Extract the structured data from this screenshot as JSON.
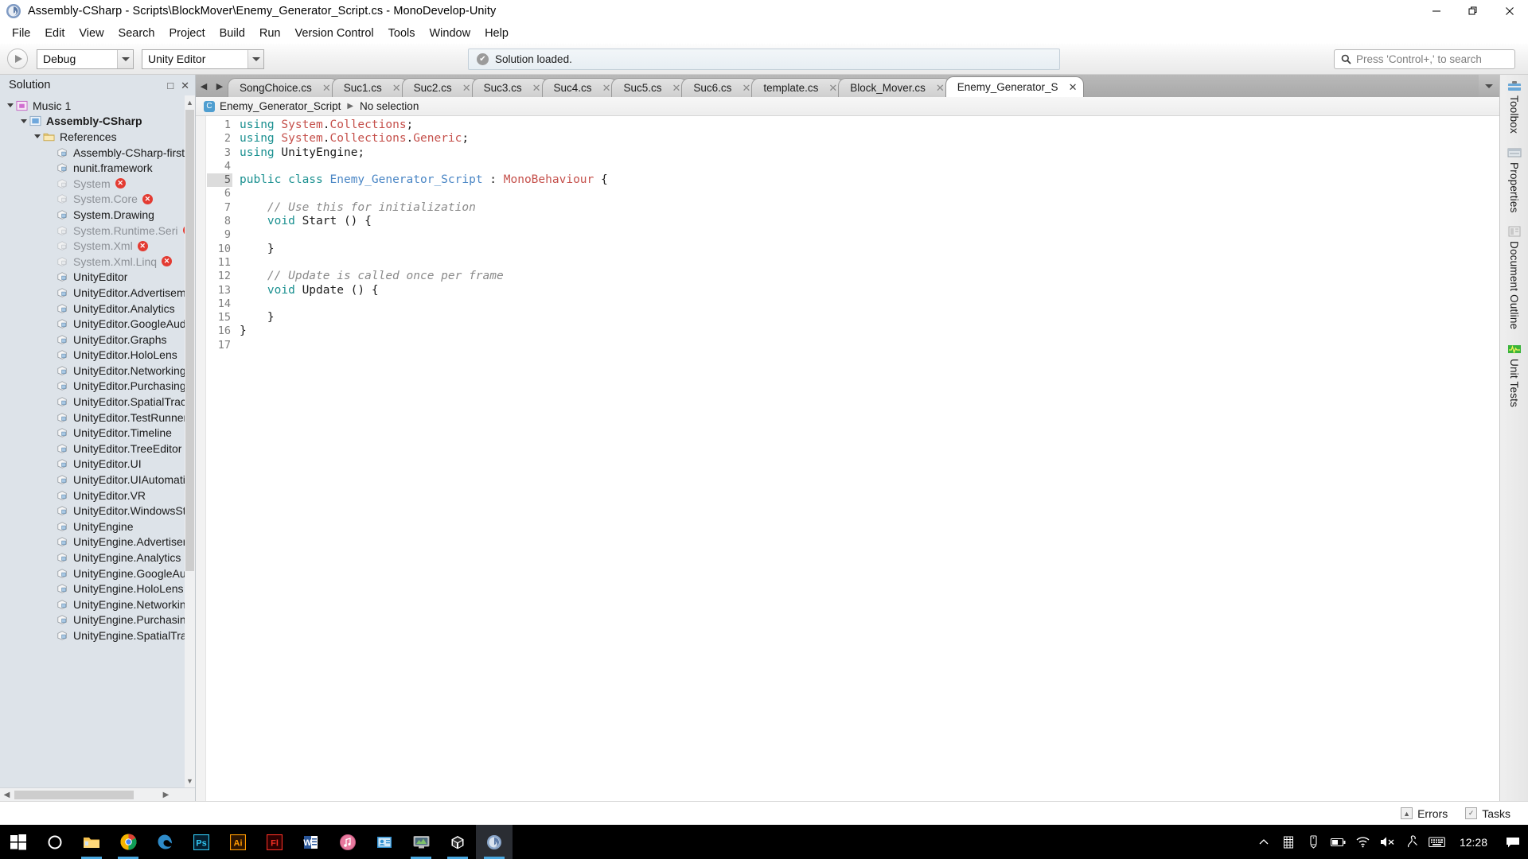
{
  "window": {
    "title": "Assembly-CSharp - Scripts\\BlockMover\\Enemy_Generator_Script.cs - MonoDevelop-Unity",
    "minimize": "─",
    "maximize": "❐",
    "close": "✕"
  },
  "menubar": {
    "items": [
      "File",
      "Edit",
      "View",
      "Search",
      "Project",
      "Build",
      "Run",
      "Version Control",
      "Tools",
      "Window",
      "Help"
    ]
  },
  "toolbar": {
    "run_label": "Run",
    "configuration": "Debug",
    "runtime": "Unity Editor",
    "status_message": "Solution loaded.",
    "status_icon": "✔",
    "search_placeholder": "Press 'Control+,' to search",
    "search_value": ""
  },
  "solution_pad": {
    "title": "Solution",
    "minimize_glyph": "□",
    "close_glyph": "✕",
    "tree": [
      {
        "label": "Music 1",
        "indent": 0,
        "expander": "down",
        "icon": "solution-icon",
        "dim": false,
        "bold": false,
        "error": false
      },
      {
        "label": "Assembly-CSharp",
        "indent": 1,
        "expander": "down",
        "icon": "project-icon",
        "dim": false,
        "bold": true,
        "error": false
      },
      {
        "label": "References",
        "indent": 2,
        "expander": "down",
        "icon": "folder-icon",
        "dim": false,
        "bold": false,
        "error": false
      },
      {
        "label": "Assembly-CSharp-firstpass",
        "indent": 3,
        "expander": "none",
        "icon": "assembly-icon",
        "dim": false,
        "bold": false,
        "error": false
      },
      {
        "label": "nunit.framework",
        "indent": 3,
        "expander": "none",
        "icon": "assembly-icon",
        "dim": false,
        "bold": false,
        "error": false
      },
      {
        "label": "System",
        "indent": 3,
        "expander": "none",
        "icon": "assembly-icon",
        "dim": true,
        "bold": false,
        "error": true
      },
      {
        "label": "System.Core",
        "indent": 3,
        "expander": "none",
        "icon": "assembly-icon",
        "dim": true,
        "bold": false,
        "error": true
      },
      {
        "label": "System.Drawing",
        "indent": 3,
        "expander": "none",
        "icon": "assembly-icon",
        "dim": false,
        "bold": false,
        "error": false
      },
      {
        "label": "System.Runtime.Serialization",
        "indent": 3,
        "expander": "none",
        "icon": "assembly-icon",
        "dim": true,
        "bold": false,
        "error": true
      },
      {
        "label": "System.Xml",
        "indent": 3,
        "expander": "none",
        "icon": "assembly-icon",
        "dim": true,
        "bold": false,
        "error": true
      },
      {
        "label": "System.Xml.Linq",
        "indent": 3,
        "expander": "none",
        "icon": "assembly-icon",
        "dim": true,
        "bold": false,
        "error": true
      },
      {
        "label": "UnityEditor",
        "indent": 3,
        "expander": "none",
        "icon": "assembly-icon",
        "dim": false,
        "bold": false,
        "error": false
      },
      {
        "label": "UnityEditor.Advertisements",
        "indent": 3,
        "expander": "none",
        "icon": "assembly-icon",
        "dim": false,
        "bold": false,
        "error": false
      },
      {
        "label": "UnityEditor.Analytics",
        "indent": 3,
        "expander": "none",
        "icon": "assembly-icon",
        "dim": false,
        "bold": false,
        "error": false
      },
      {
        "label": "UnityEditor.GoogleAudioSpatia",
        "indent": 3,
        "expander": "none",
        "icon": "assembly-icon",
        "dim": false,
        "bold": false,
        "error": false
      },
      {
        "label": "UnityEditor.Graphs",
        "indent": 3,
        "expander": "none",
        "icon": "assembly-icon",
        "dim": false,
        "bold": false,
        "error": false
      },
      {
        "label": "UnityEditor.HoloLens",
        "indent": 3,
        "expander": "none",
        "icon": "assembly-icon",
        "dim": false,
        "bold": false,
        "error": false
      },
      {
        "label": "UnityEditor.Networking",
        "indent": 3,
        "expander": "none",
        "icon": "assembly-icon",
        "dim": false,
        "bold": false,
        "error": false
      },
      {
        "label": "UnityEditor.Purchasing",
        "indent": 3,
        "expander": "none",
        "icon": "assembly-icon",
        "dim": false,
        "bold": false,
        "error": false
      },
      {
        "label": "UnityEditor.SpatialTracking",
        "indent": 3,
        "expander": "none",
        "icon": "assembly-icon",
        "dim": false,
        "bold": false,
        "error": false
      },
      {
        "label": "UnityEditor.TestRunner",
        "indent": 3,
        "expander": "none",
        "icon": "assembly-icon",
        "dim": false,
        "bold": false,
        "error": false
      },
      {
        "label": "UnityEditor.Timeline",
        "indent": 3,
        "expander": "none",
        "icon": "assembly-icon",
        "dim": false,
        "bold": false,
        "error": false
      },
      {
        "label": "UnityEditor.TreeEditor",
        "indent": 3,
        "expander": "none",
        "icon": "assembly-icon",
        "dim": false,
        "bold": false,
        "error": false
      },
      {
        "label": "UnityEditor.UI",
        "indent": 3,
        "expander": "none",
        "icon": "assembly-icon",
        "dim": false,
        "bold": false,
        "error": false
      },
      {
        "label": "UnityEditor.UIAutomation",
        "indent": 3,
        "expander": "none",
        "icon": "assembly-icon",
        "dim": false,
        "bold": false,
        "error": false
      },
      {
        "label": "UnityEditor.VR",
        "indent": 3,
        "expander": "none",
        "icon": "assembly-icon",
        "dim": false,
        "bold": false,
        "error": false
      },
      {
        "label": "UnityEditor.WindowsStandalone",
        "indent": 3,
        "expander": "none",
        "icon": "assembly-icon",
        "dim": false,
        "bold": false,
        "error": false
      },
      {
        "label": "UnityEngine",
        "indent": 3,
        "expander": "none",
        "icon": "assembly-icon",
        "dim": false,
        "bold": false,
        "error": false
      },
      {
        "label": "UnityEngine.Advertisements",
        "indent": 3,
        "expander": "none",
        "icon": "assembly-icon",
        "dim": false,
        "bold": false,
        "error": false
      },
      {
        "label": "UnityEngine.Analytics",
        "indent": 3,
        "expander": "none",
        "icon": "assembly-icon",
        "dim": false,
        "bold": false,
        "error": false
      },
      {
        "label": "UnityEngine.GoogleAudioSpatia",
        "indent": 3,
        "expander": "none",
        "icon": "assembly-icon",
        "dim": false,
        "bold": false,
        "error": false
      },
      {
        "label": "UnityEngine.HoloLens",
        "indent": 3,
        "expander": "none",
        "icon": "assembly-icon",
        "dim": false,
        "bold": false,
        "error": false
      },
      {
        "label": "UnityEngine.Networking",
        "indent": 3,
        "expander": "none",
        "icon": "assembly-icon",
        "dim": false,
        "bold": false,
        "error": false
      },
      {
        "label": "UnityEngine.Purchasing",
        "indent": 3,
        "expander": "none",
        "icon": "assembly-icon",
        "dim": false,
        "bold": false,
        "error": false
      },
      {
        "label": "UnityEngine.SpatialTracking",
        "indent": 3,
        "expander": "none",
        "icon": "assembly-icon",
        "dim": false,
        "bold": false,
        "error": false
      }
    ]
  },
  "tabs": {
    "prev_glyph": "◀",
    "next_glyph": "▶",
    "dropdown_glyph": "▼",
    "close_glyph": "✕",
    "items": [
      {
        "label": "SongChoice.cs",
        "active": false
      },
      {
        "label": "Suc1.cs",
        "active": false
      },
      {
        "label": "Suc2.cs",
        "active": false
      },
      {
        "label": "Suc3.cs",
        "active": false
      },
      {
        "label": "Suc4.cs",
        "active": false
      },
      {
        "label": "Suc5.cs",
        "active": false
      },
      {
        "label": "Suc6.cs",
        "active": false
      },
      {
        "label": "template.cs",
        "active": false
      },
      {
        "label": "Block_Mover.cs",
        "active": false
      },
      {
        "label": "Enemy_Generator_S",
        "active": true
      }
    ]
  },
  "breadcrumb": {
    "class_name": "Enemy_Generator_Script",
    "separator": "▶",
    "member": "No selection"
  },
  "editor": {
    "current_line": 5,
    "lines": [
      {
        "n": "1",
        "tokens": [
          {
            "t": "using ",
            "c": "kw"
          },
          {
            "t": "System",
            "c": "type"
          },
          {
            "t": ".",
            "c": "plain"
          },
          {
            "t": "Collections",
            "c": "type"
          },
          {
            "t": ";",
            "c": "plain"
          }
        ]
      },
      {
        "n": "2",
        "tokens": [
          {
            "t": "using ",
            "c": "kw"
          },
          {
            "t": "System",
            "c": "type"
          },
          {
            "t": ".",
            "c": "plain"
          },
          {
            "t": "Collections",
            "c": "type"
          },
          {
            "t": ".",
            "c": "plain"
          },
          {
            "t": "Generic",
            "c": "type"
          },
          {
            "t": ";",
            "c": "plain"
          }
        ]
      },
      {
        "n": "3",
        "tokens": [
          {
            "t": "using ",
            "c": "kw"
          },
          {
            "t": "UnityEngine",
            "c": "plain"
          },
          {
            "t": ";",
            "c": "plain"
          }
        ]
      },
      {
        "n": "4",
        "tokens": []
      },
      {
        "n": "5",
        "tokens": [
          {
            "t": "public ",
            "c": "kw"
          },
          {
            "t": "class ",
            "c": "kw"
          },
          {
            "t": "Enemy_Generator_Script",
            "c": "cls"
          },
          {
            "t": " : ",
            "c": "plain"
          },
          {
            "t": "MonoBehaviour",
            "c": "type"
          },
          {
            "t": " {",
            "c": "plain"
          }
        ]
      },
      {
        "n": "6",
        "tokens": []
      },
      {
        "n": "7",
        "tokens": [
          {
            "t": "    // Use this for initialization",
            "c": "cmt"
          }
        ]
      },
      {
        "n": "8",
        "tokens": [
          {
            "t": "    ",
            "c": "plain"
          },
          {
            "t": "void ",
            "c": "kw"
          },
          {
            "t": "Start () {",
            "c": "plain"
          }
        ]
      },
      {
        "n": "9",
        "tokens": []
      },
      {
        "n": "10",
        "tokens": [
          {
            "t": "    }",
            "c": "plain"
          }
        ]
      },
      {
        "n": "11",
        "tokens": []
      },
      {
        "n": "12",
        "tokens": [
          {
            "t": "    // Update is called once per frame",
            "c": "cmt"
          }
        ]
      },
      {
        "n": "13",
        "tokens": [
          {
            "t": "    ",
            "c": "plain"
          },
          {
            "t": "void ",
            "c": "kw"
          },
          {
            "t": "Update () {",
            "c": "plain"
          }
        ]
      },
      {
        "n": "14",
        "tokens": []
      },
      {
        "n": "15",
        "tokens": [
          {
            "t": "    }",
            "c": "plain"
          }
        ]
      },
      {
        "n": "16",
        "tokens": [
          {
            "t": "}",
            "c": "plain"
          }
        ]
      },
      {
        "n": "17",
        "tokens": []
      }
    ]
  },
  "right_dock": {
    "items": [
      {
        "label": "Toolbox",
        "icon": "toolbox-icon"
      },
      {
        "label": "Properties",
        "icon": "properties-icon"
      },
      {
        "label": "Document Outline",
        "icon": "document-outline-icon"
      },
      {
        "label": "Unit Tests",
        "icon": "unit-tests-icon"
      }
    ]
  },
  "bottom_status": {
    "errors_label": "Errors",
    "errors_glyph": "▲",
    "tasks_label": "Tasks",
    "tasks_glyph": "✓"
  },
  "taskbar": {
    "apps": [
      {
        "name": "start-button",
        "glyph": "start",
        "active": false,
        "running": false
      },
      {
        "name": "cortana-search",
        "glyph": "cortana",
        "active": false,
        "running": false
      },
      {
        "name": "file-explorer",
        "glyph": "folder",
        "active": false,
        "running": true
      },
      {
        "name": "google-chrome",
        "glyph": "chrome",
        "active": false,
        "running": true
      },
      {
        "name": "microsoft-edge",
        "glyph": "edge",
        "active": false,
        "running": false
      },
      {
        "name": "photoshop",
        "glyph": "Ps",
        "active": false,
        "running": false
      },
      {
        "name": "illustrator",
        "glyph": "Ai",
        "active": false,
        "running": false
      },
      {
        "name": "flash",
        "glyph": "Fl",
        "active": false,
        "running": false
      },
      {
        "name": "microsoft-word",
        "glyph": "W",
        "active": false,
        "running": false
      },
      {
        "name": "itunes",
        "glyph": "itunes",
        "active": false,
        "running": false
      },
      {
        "name": "contacts-app",
        "glyph": "contacts",
        "active": false,
        "running": false
      },
      {
        "name": "unity-hub",
        "glyph": "monitor",
        "active": false,
        "running": true
      },
      {
        "name": "unity-editor",
        "glyph": "unity",
        "active": false,
        "running": true
      },
      {
        "name": "monodevelop-unity",
        "glyph": "monodevelop",
        "active": true,
        "running": true
      }
    ],
    "tray": [
      {
        "name": "show-hidden-icons",
        "glyph": "chevron-up"
      },
      {
        "name": "onenote-tray-icon",
        "glyph": "grid"
      },
      {
        "name": "safely-remove-hardware-icon",
        "glyph": "usb"
      },
      {
        "name": "battery-icon",
        "glyph": "battery"
      },
      {
        "name": "wifi-icon",
        "glyph": "wifi"
      },
      {
        "name": "volume-muted-icon",
        "glyph": "speaker-mute"
      },
      {
        "name": "pen-workspace-icon",
        "glyph": "pen"
      },
      {
        "name": "touch-keyboard-icon",
        "glyph": "keyboard"
      }
    ],
    "clock": "12:28",
    "action_center": "notifications-icon"
  },
  "colors": {
    "accent_blue": "#4a86c5",
    "keyword_teal": "#1a9090",
    "type_red": "#c5504b",
    "comment_gray": "#8a8a8a",
    "error_red": "#e33b32",
    "pad_bg": "#dde3e9",
    "taskbar_bg": "#000000"
  }
}
